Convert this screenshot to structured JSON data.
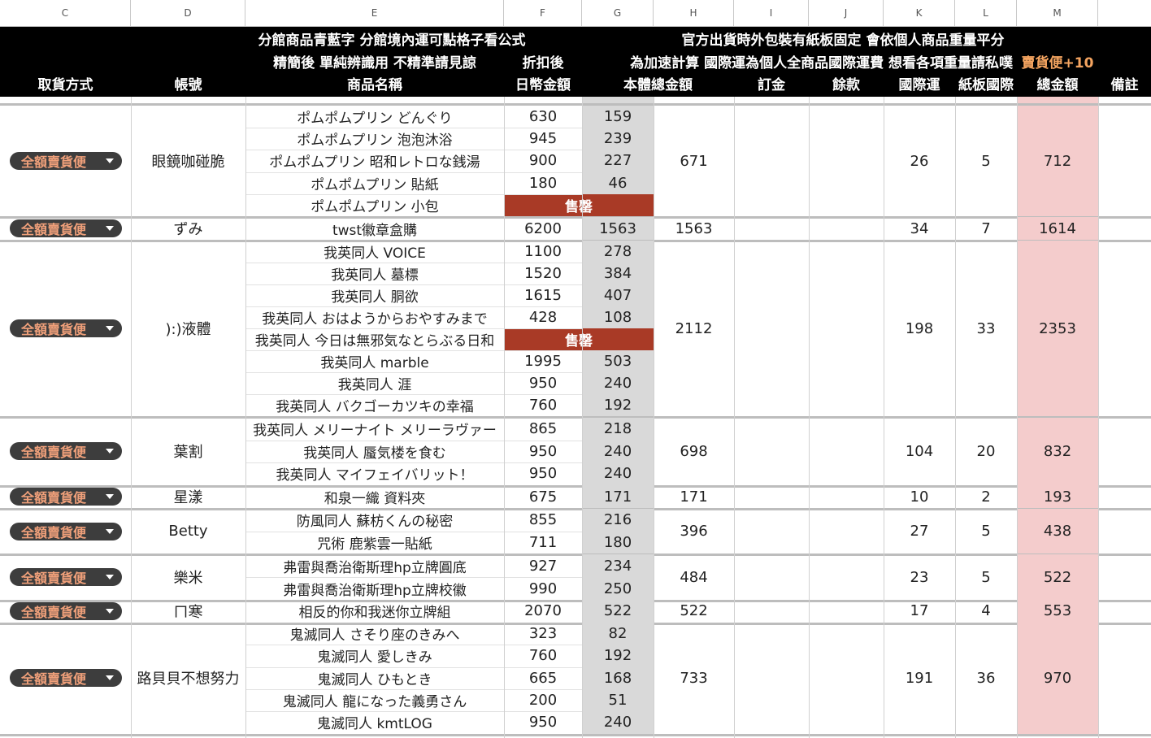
{
  "columns": [
    "C",
    "D",
    "E",
    "F",
    "G",
    "H",
    "I",
    "J",
    "K",
    "L",
    "M"
  ],
  "header": {
    "note_e": "分館商品青藍字 分館境內運可點格子看公式",
    "note_e2": "精簡後 單純辨識用 不精準請見諒",
    "note_h": "官方出貨時外包裝有紙板固定 會依個人商品重量平分",
    "note_h2": "為加速計算 國際運為個人全商品國際運費 想看各項重量請私噗",
    "note_m": "賣貨便+10",
    "discount": "折扣後",
    "labels": {
      "c": "取貨方式",
      "d": "帳號",
      "e": "商品名稱",
      "f": "日幣金額",
      "h": "本體總金額",
      "i": "訂金",
      "j": "餘款",
      "k": "國際運",
      "l": "紙板國際",
      "m": "總金額",
      "n": "備註"
    }
  },
  "pickup_label": "全額賣貨便",
  "sold_out_label": "售罄",
  "groups": [
    {
      "account": "眼鏡咖碰脆",
      "total": "671",
      "intl": "26",
      "board": "5",
      "grand": "712",
      "items": [
        [
          "ポムポムプリン どんぐり",
          "630",
          "159"
        ],
        [
          "ポムポムプリン 泡泡沐浴",
          "945",
          "239"
        ],
        [
          "ポムポムプリン 昭和レトロな銭湯",
          "900",
          "227"
        ],
        [
          "ポムポムプリン 貼紙",
          "180",
          "46"
        ],
        [
          "ポムポムプリン 小包",
          "售罄",
          ""
        ]
      ]
    },
    {
      "account": "ずみ",
      "total": "1563",
      "intl": "34",
      "board": "7",
      "grand": "1614",
      "items": [
        [
          "twst徽章盒購",
          "6200",
          "1563"
        ]
      ]
    },
    {
      "account": "):)液體",
      "total": "2112",
      "intl": "198",
      "board": "33",
      "grand": "2353",
      "items": [
        [
          "我英同人 VOICE",
          "1100",
          "278"
        ],
        [
          "我英同人 墓標",
          "1520",
          "384"
        ],
        [
          "我英同人 胴欲",
          "1615",
          "407"
        ],
        [
          "我英同人 おはようからおやすみまで",
          "428",
          "108"
        ],
        [
          "我英同人 今日は無邪気なとらぶる日和",
          "售罄",
          ""
        ],
        [
          "我英同人 marble",
          "1995",
          "503"
        ],
        [
          "我英同人 涯",
          "950",
          "240"
        ],
        [
          "我英同人 バクゴーカツキの幸福",
          "760",
          "192"
        ]
      ]
    },
    {
      "account": "葉割",
      "total": "698",
      "intl": "104",
      "board": "20",
      "grand": "832",
      "items": [
        [
          "我英同人 メリーナイト メリーラヴァー",
          "865",
          "218"
        ],
        [
          "我英同人 蜃気楼を食む",
          "950",
          "240"
        ],
        [
          "我英同人 マイフェイバリット！",
          "950",
          "240"
        ]
      ]
    },
    {
      "account": "星漾",
      "total": "171",
      "intl": "10",
      "board": "2",
      "grand": "193",
      "items": [
        [
          "和泉一織 資料夾",
          "675",
          "171"
        ]
      ]
    },
    {
      "account": "Betty",
      "total": "396",
      "intl": "27",
      "board": "5",
      "grand": "438",
      "items": [
        [
          "防風同人 蘇枋くんの秘密",
          "855",
          "216"
        ],
        [
          "咒術 鹿紫雲一貼紙",
          "711",
          "180"
        ]
      ]
    },
    {
      "account": "樂米",
      "total": "484",
      "intl": "23",
      "board": "5",
      "grand": "522",
      "items": [
        [
          "弗雷與喬治衛斯理hp立牌圓底",
          "927",
          "234"
        ],
        [
          "弗雷與喬治衛斯理hp立牌校徽",
          "990",
          "250"
        ]
      ]
    },
    {
      "account": "ㄇ寒",
      "total": "522",
      "intl": "17",
      "board": "4",
      "grand": "553",
      "items": [
        [
          "相反的你和我迷你立牌組",
          "2070",
          "522"
        ]
      ]
    },
    {
      "account": "路貝貝不想努力",
      "total": "733",
      "intl": "191",
      "board": "36",
      "grand": "970",
      "items": [
        [
          "鬼滅同人 さそり座のきみへ",
          "323",
          "82"
        ],
        [
          "鬼滅同人 愛しきみ",
          "760",
          "192"
        ],
        [
          "鬼滅同人 ひもとき",
          "665",
          "168"
        ],
        [
          "鬼滅同人 龍になった義勇さん",
          "200",
          "51"
        ],
        [
          "鬼滅同人 kmtLOG",
          "950",
          "240"
        ]
      ]
    }
  ]
}
